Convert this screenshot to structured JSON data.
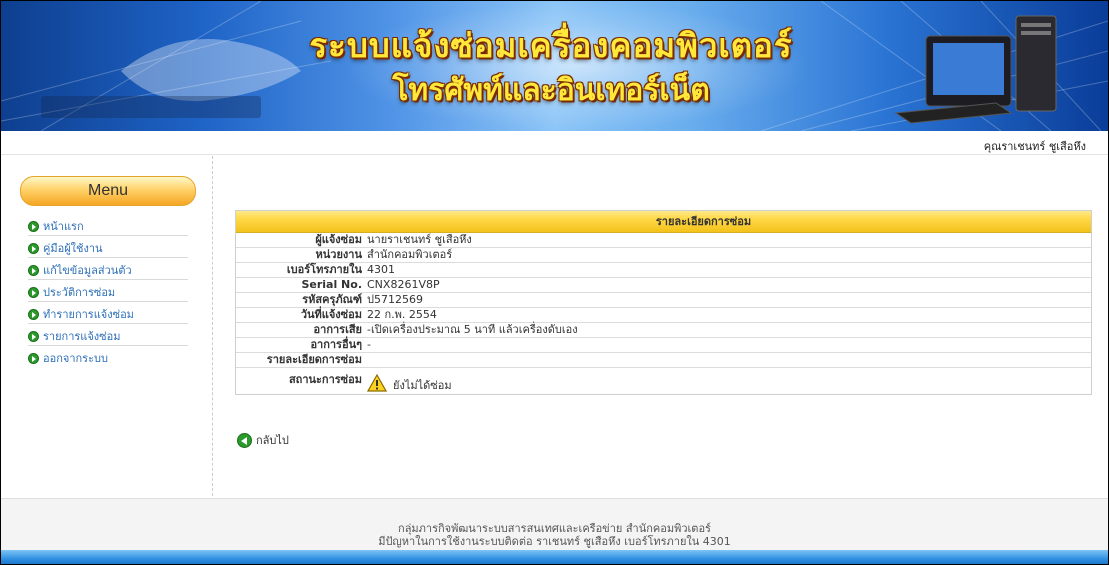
{
  "banner": {
    "title_line1": "ระบบแจ้งซ่อมเครื่องคอมพิวเตอร์",
    "title_line2": "โทรศัพท์และอินเทอร์เน็ต"
  },
  "user": {
    "display_name": "คุณราเชนทร์ ชูเสือหึง"
  },
  "sidebar": {
    "menu_title": "Menu",
    "items": [
      {
        "label": "หน้าแรก"
      },
      {
        "label": "คู่มือผู้ใช้งาน"
      },
      {
        "label": "แก้ไขข้อมูลส่วนตัว"
      },
      {
        "label": "ประวัติการซ่อม"
      },
      {
        "label": "ทำรายการแจ้งซ่อม"
      },
      {
        "label": "รายการแจ้งซ่อม"
      },
      {
        "label": "ออกจากระบบ"
      }
    ]
  },
  "detail": {
    "title": "รายละเอียดการซ่อม",
    "rows": [
      {
        "label": "ผู้แจ้งซ่อม",
        "value": "นายราเชนทร์ ชูเสือหึง"
      },
      {
        "label": "หน่วยงาน",
        "value": "สำนักคอมพิวเตอร์"
      },
      {
        "label": "เบอร์โทรภายใน",
        "value": "4301"
      },
      {
        "label": "Serial No.",
        "value": "CNX8261V8P"
      },
      {
        "label": "รหัสครุภัณฑ์",
        "value": "ป5712569"
      },
      {
        "label": "วันที่แจ้งซ่อม",
        "value": "22 ก.พ. 2554"
      },
      {
        "label": "อาการเสีย",
        "value": "-เปิดเครื่องประมาณ 5 นาที แล้วเครื่องดับเอง"
      },
      {
        "label": "อาการอื่นๆ",
        "value": "-"
      },
      {
        "label": "รายละเอียดการซ่อม",
        "value": ""
      }
    ],
    "status_label": "สถานะการซ่อม",
    "status_value": "ยังไม่ได้ซ่อม",
    "status_icon": "warning-icon"
  },
  "back_link": "กลับไป",
  "footer": {
    "line1": "กลุ่มภารกิจพัฒนาระบบสารสนเทศและเครือข่าย สำนักคอมพิวเตอร์",
    "line2": "มีปัญหาในการใช้งานระบบติดต่อ ราเชนทร์ ชูเสือหึง เบอร์โทรภายใน 4301"
  },
  "colors": {
    "accent_yellow": "#f3c21a",
    "link_blue": "#2d6fb8",
    "bullet_green": "#2a9a2a"
  }
}
